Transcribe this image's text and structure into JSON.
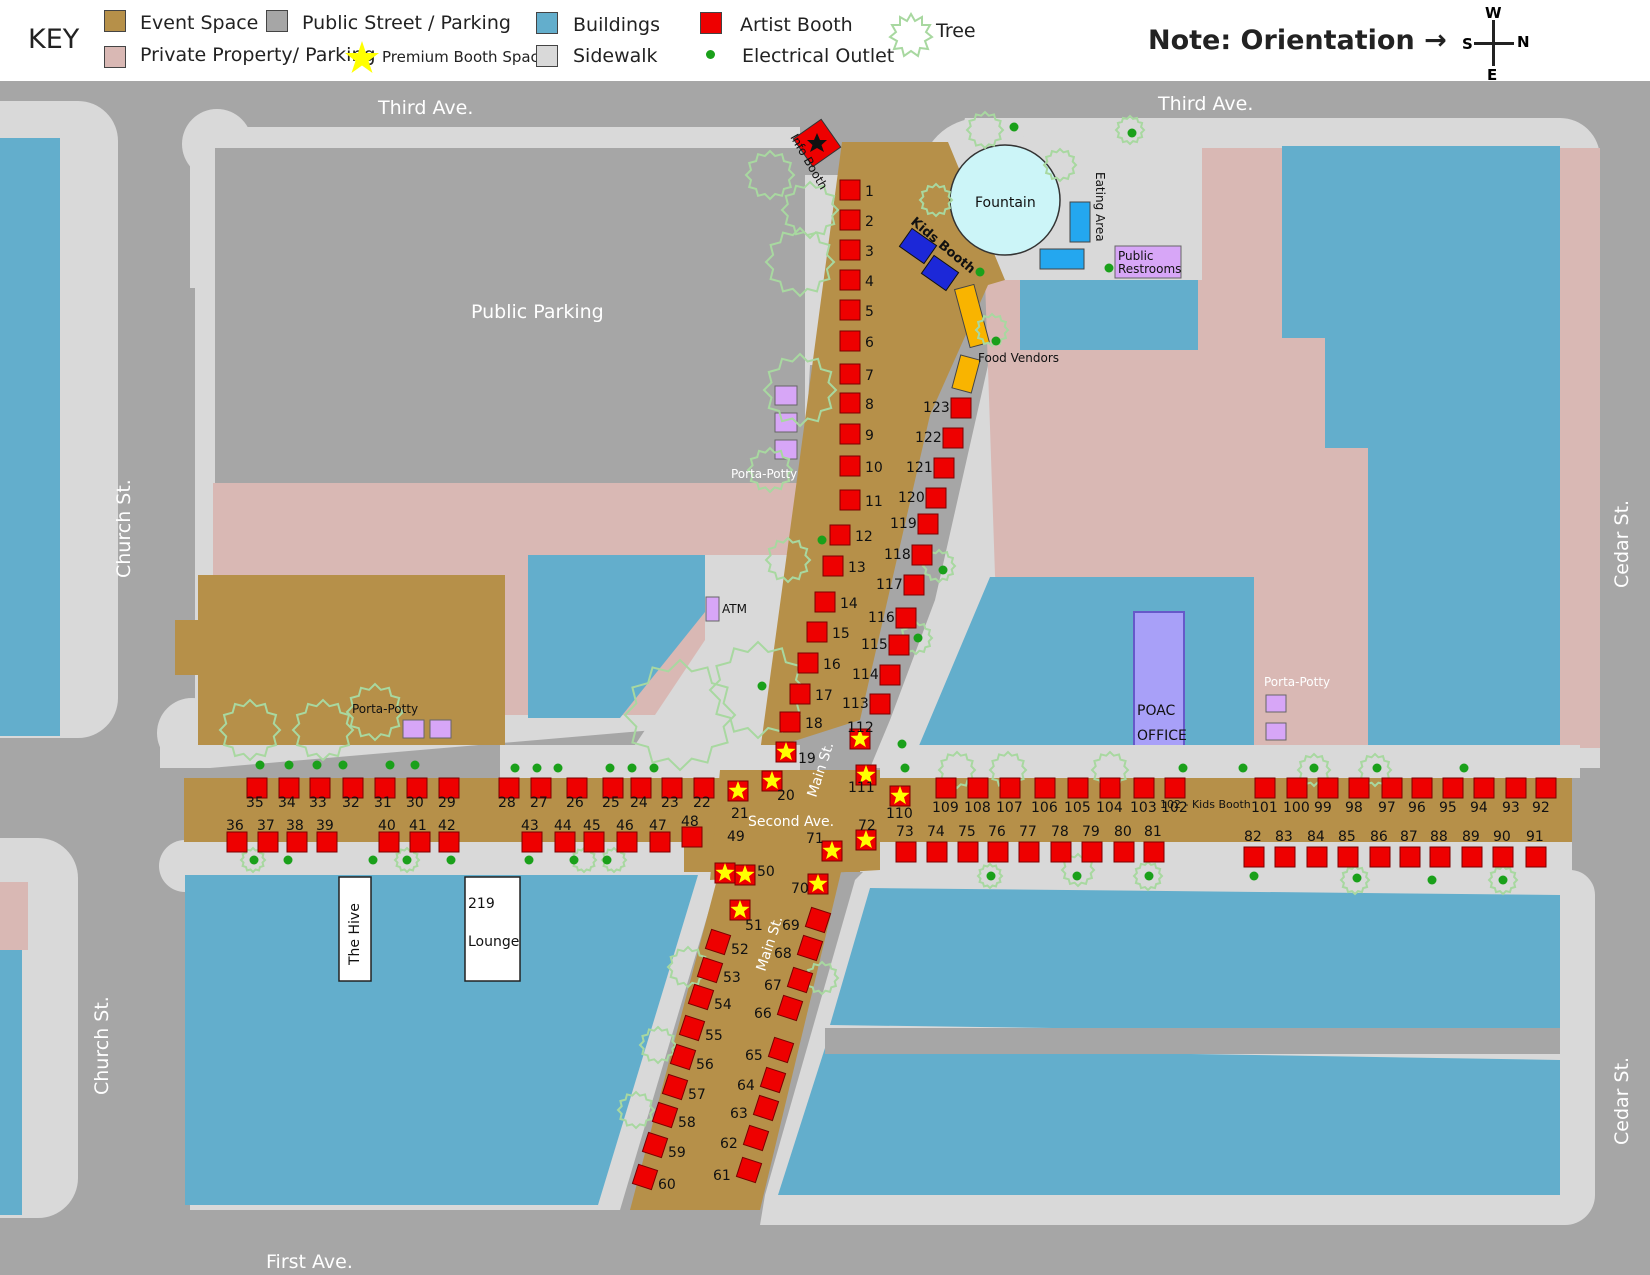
{
  "legend": {
    "key": "KEY",
    "items": {
      "event": "Event Space",
      "private": "Private Property/ Parking",
      "street": "Public Street / Parking",
      "premium": "Premium Booth Space",
      "buildings": "Buildings",
      "sidewalk": "Sidewalk",
      "artist": "Artist Booth",
      "outlet": "Electrical Outlet",
      "tree": "Tree"
    },
    "orientation_note": "Note: Orientation →",
    "compass": {
      "w": "W",
      "s": "S",
      "n": "N",
      "e": "E"
    }
  },
  "colors": {
    "event": "#b69049",
    "street": "#a6a6a6",
    "private": "#d9b8b4",
    "building": "#63aecc",
    "sidewalk": "#d9d9d9",
    "booth": "#ee0000",
    "star": "#ffff00",
    "outlet": "#1aa01a",
    "tree": "#a8d8a0"
  },
  "streets": {
    "third_ave_left": "Third Ave.",
    "third_ave_right": "Third Ave.",
    "church_upper": "Church St.",
    "church_lower": "Church St.",
    "cedar_upper": "Cedar St.",
    "cedar_lower": "Cedar St.",
    "first_ave": "First Ave.",
    "second_ave": "Second Ave.",
    "main_upper": "Main St.",
    "main_lower": "Main St."
  },
  "places": {
    "public_parking": "Public Parking",
    "fountain": "Fountain",
    "eating_area": "Eating Area",
    "public_restrooms": "Public Restrooms",
    "kids_booth": "Kids Booth",
    "food_vendors": "Food Vendors",
    "info_booth": "Info Booth",
    "porta_potty_top": "Porta-Potty",
    "porta_potty_left": "Porta-Potty",
    "porta_potty_right": "Porta-Potty",
    "atm": "ATM",
    "poac_office": "POAC OFFICE",
    "the_hive": "The Hive",
    "lounge_219": "219 Lounge",
    "kids_booth_102": "102 - Kids Booth"
  },
  "booths": {
    "count": 123,
    "premium": [
      19,
      20,
      21,
      49,
      50,
      51,
      70,
      71,
      72,
      110,
      111,
      112
    ],
    "kids_booth_number": 102
  }
}
